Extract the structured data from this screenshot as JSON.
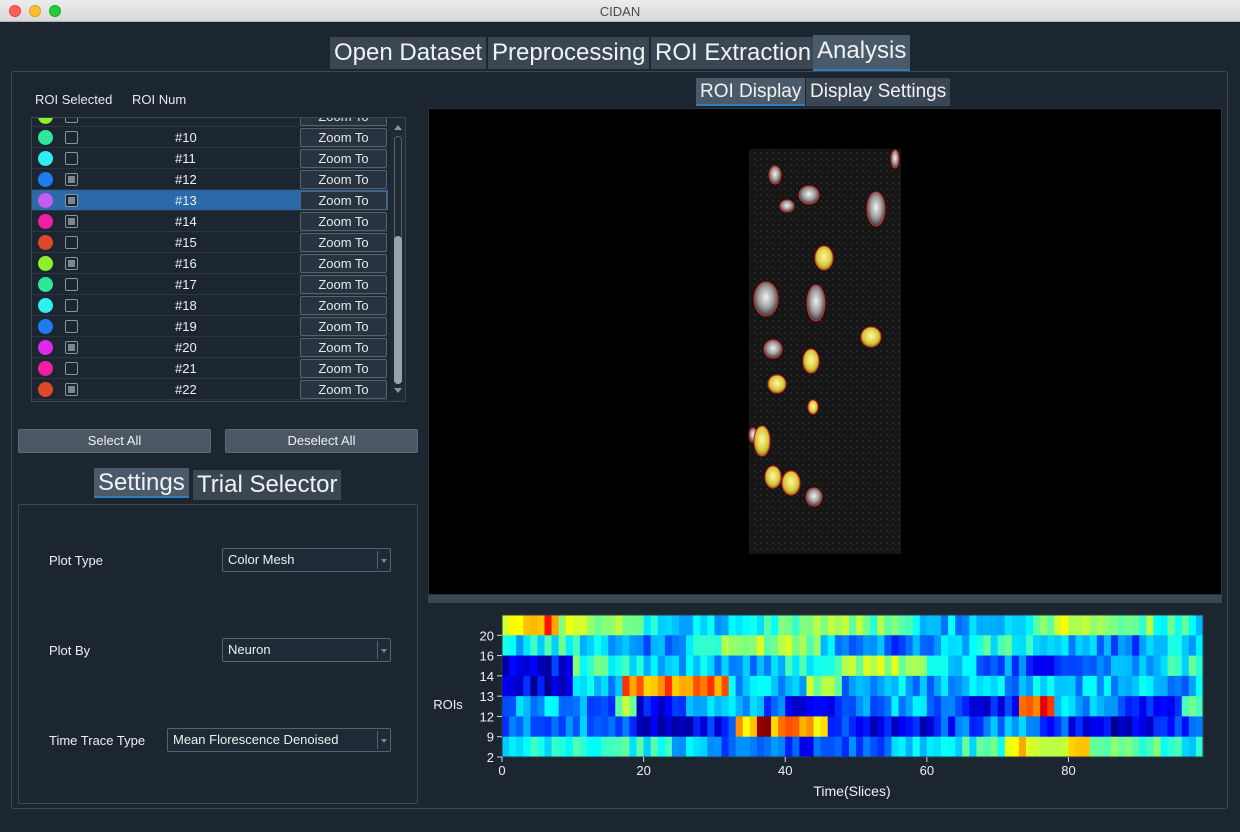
{
  "window": {
    "title": "CIDAN"
  },
  "main_tabs": [
    {
      "label": "Open Dataset"
    },
    {
      "label": "Preprocessing"
    },
    {
      "label": "ROI Extraction"
    },
    {
      "label": "Analysis"
    }
  ],
  "roi_list": {
    "header_selected": "ROI Selected",
    "header_num": "ROI Num",
    "rows": [
      {
        "num": "#10",
        "color": "#2ee89a",
        "checked": false,
        "zoom": "Zoom To"
      },
      {
        "num": "#11",
        "color": "#2ef0f0",
        "checked": false,
        "zoom": "Zoom To"
      },
      {
        "num": "#12",
        "color": "#1e7cf0",
        "checked": true,
        "zoom": "Zoom To"
      },
      {
        "num": "#13",
        "color": "#c65cf0",
        "checked": true,
        "zoom": "Zoom To",
        "selected": true
      },
      {
        "num": "#14",
        "color": "#f01ea0",
        "checked": true,
        "zoom": "Zoom To"
      },
      {
        "num": "#15",
        "color": "#e0482a",
        "checked": false,
        "zoom": "Zoom To"
      },
      {
        "num": "#16",
        "color": "#8ef02a",
        "checked": true,
        "zoom": "Zoom To"
      },
      {
        "num": "#17",
        "color": "#2ee89a",
        "checked": false,
        "zoom": "Zoom To"
      },
      {
        "num": "#18",
        "color": "#2ef0f0",
        "checked": false,
        "zoom": "Zoom To"
      },
      {
        "num": "#19",
        "color": "#1e7cf0",
        "checked": false,
        "zoom": "Zoom To"
      },
      {
        "num": "#20",
        "color": "#e028e8",
        "checked": true,
        "zoom": "Zoom To"
      },
      {
        "num": "#21",
        "color": "#f01ea0",
        "checked": false,
        "zoom": "Zoom To"
      },
      {
        "num": "#22",
        "color": "#e0482a",
        "checked": true,
        "zoom": "Zoom To"
      }
    ]
  },
  "buttons": {
    "select_all": "Select All",
    "deselect_all": "Deselect All"
  },
  "settings_tabs": [
    {
      "label": "Settings"
    },
    {
      "label": "Trial Selector"
    }
  ],
  "settings": {
    "plot_type": {
      "label": "Plot Type",
      "value": "Color Mesh"
    },
    "plot_by": {
      "label": "Plot By",
      "value": "Neuron"
    },
    "time_trace_type": {
      "label": "Time Trace Type",
      "value": "Mean Florescence Denoised"
    }
  },
  "display_tabs": [
    {
      "label": "ROI Display"
    },
    {
      "label": "Display Settings"
    }
  ],
  "chart_data": {
    "type": "heatmap",
    "xlabel": "Time(Slices)",
    "ylabel": "ROIs",
    "x_ticks": [
      "0",
      "20",
      "40",
      "60",
      "80"
    ],
    "y_ticks": [
      "2",
      "9",
      "12",
      "13",
      "14",
      "16",
      "20"
    ],
    "xlim": [
      0,
      99
    ],
    "colormap": "jet"
  }
}
